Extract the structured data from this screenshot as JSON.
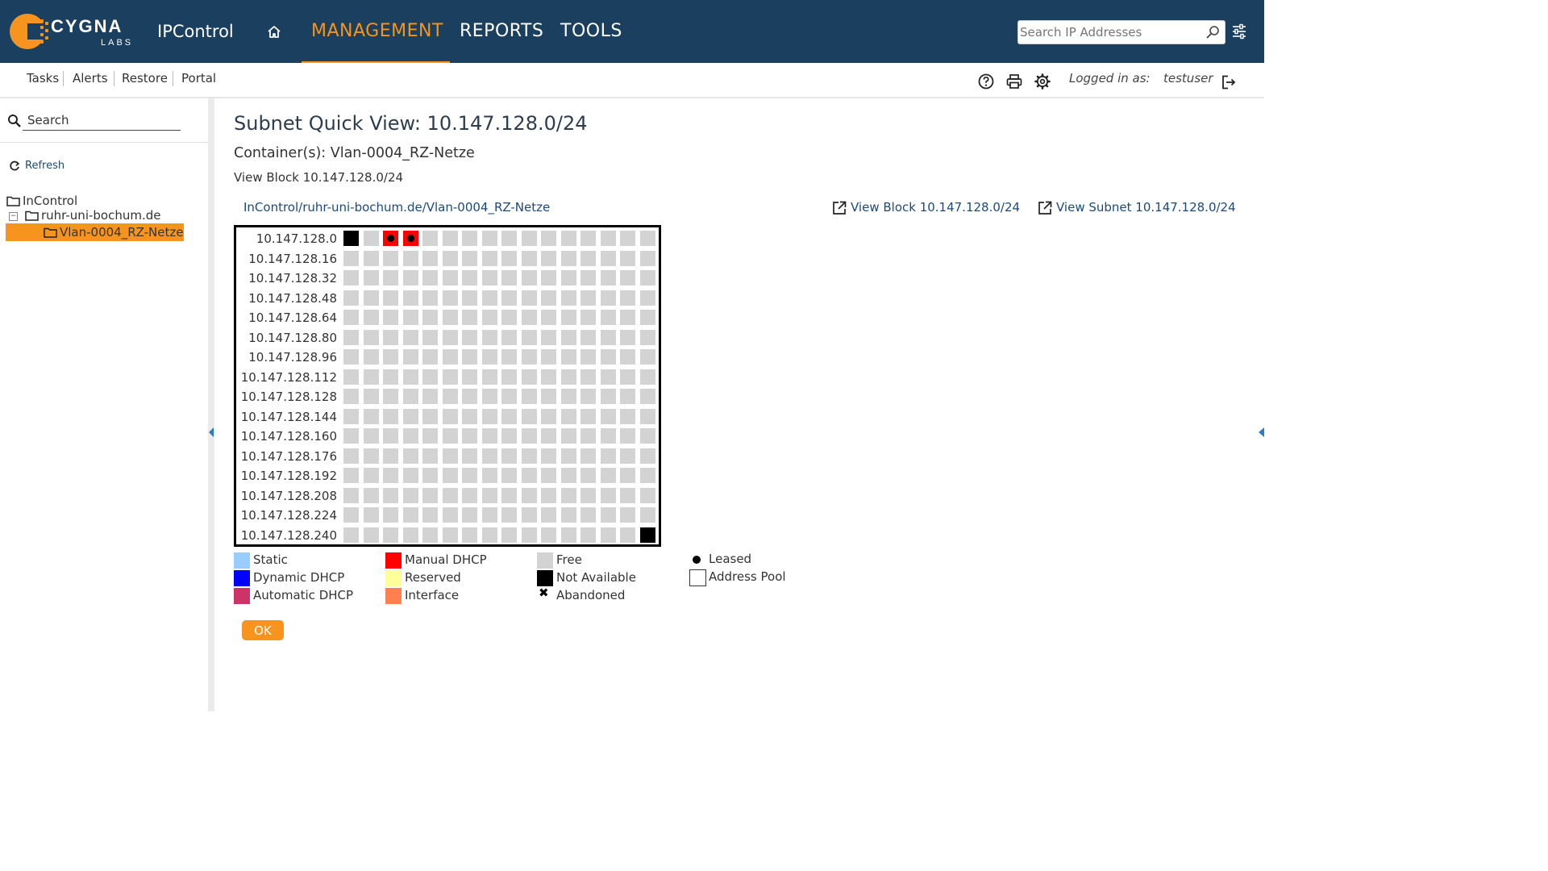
{
  "header": {
    "logo_text": "CYGNA",
    "logo_sub": "LABS",
    "app_name": "IPControl",
    "nav": [
      "MANAGEMENT",
      "REPORTS",
      "TOOLS"
    ],
    "active_nav": "MANAGEMENT",
    "search_placeholder": "Search IP Addresses",
    "accent_color": "#f7941d",
    "bg_color": "#1b3f5e",
    "icons": [
      "home-icon",
      "magnifier-icon",
      "sliders-icon"
    ]
  },
  "subnav": {
    "links": [
      "Tasks",
      "Alerts",
      "Restore",
      "Portal"
    ],
    "tool_icons": [
      "help-icon",
      "print-icon",
      "gear-icon",
      "logout-icon"
    ],
    "logged_in_label": "Logged in as:",
    "username": "testuser"
  },
  "sidebar": {
    "search_placeholder": "Search",
    "refresh_label": "Refresh",
    "tree": [
      {
        "label": "InControl",
        "level": 0,
        "selected": false
      },
      {
        "label": "ruhr-uni-bochum.de",
        "level": 1,
        "selected": false
      },
      {
        "label": "Vlan-0004_RZ-Netze",
        "level": 2,
        "selected": true
      }
    ]
  },
  "main": {
    "title": "Subnet Quick View: 10.147.128.0/24",
    "container_line": "Container(s): Vlan-0004_RZ-Netze",
    "block_line": "View Block 10.147.128.0/24",
    "path_link": "InControl/ruhr-uni-bochum.de/Vlan-0004_RZ-Netze",
    "view_block_link": "View Block 10.147.128.0/24",
    "view_subnet_link": "View Subnet 10.147.128.0/24",
    "ok_label": "OK"
  },
  "grid": {
    "row_labels": [
      "10.147.128.0",
      "10.147.128.16",
      "10.147.128.32",
      "10.147.128.48",
      "10.147.128.64",
      "10.147.128.80",
      "10.147.128.96",
      "10.147.128.112",
      "10.147.128.128",
      "10.147.128.144",
      "10.147.128.160",
      "10.147.128.176",
      "10.147.128.192",
      "10.147.128.208",
      "10.147.128.224",
      "10.147.128.240"
    ],
    "columns": 16,
    "special_cells": [
      {
        "row": 0,
        "col": 0,
        "status": "Not Available",
        "leased": false
      },
      {
        "row": 0,
        "col": 2,
        "status": "Manual DHCP",
        "leased": true
      },
      {
        "row": 0,
        "col": 3,
        "status": "Manual DHCP",
        "leased": true
      },
      {
        "row": 15,
        "col": 15,
        "status": "Not Available",
        "leased": false
      }
    ],
    "default_status": "Free"
  },
  "legend": {
    "items": [
      {
        "label": "Static",
        "color": "#99ccff",
        "kind": "swatch"
      },
      {
        "label": "Dynamic DHCP",
        "color": "#0000ff",
        "kind": "swatch"
      },
      {
        "label": "Automatic DHCP",
        "color": "#cc3366",
        "kind": "swatch"
      },
      {
        "label": "Manual DHCP",
        "color": "#ff0000",
        "kind": "swatch"
      },
      {
        "label": "Reserved",
        "color": "#ffff99",
        "kind": "swatch"
      },
      {
        "label": "Interface",
        "color": "#ff7f50",
        "kind": "swatch"
      },
      {
        "label": "Free",
        "color": "#d3d3d3",
        "kind": "swatch"
      },
      {
        "label": "Not Available",
        "color": "#000000",
        "kind": "swatch"
      },
      {
        "label": "Abandoned",
        "color": "#000000",
        "kind": "x-mark"
      },
      {
        "label": "Leased",
        "color": "#000000",
        "kind": "dot"
      },
      {
        "label": "Address Pool",
        "color": "#ffffff",
        "kind": "outline-box"
      }
    ]
  }
}
